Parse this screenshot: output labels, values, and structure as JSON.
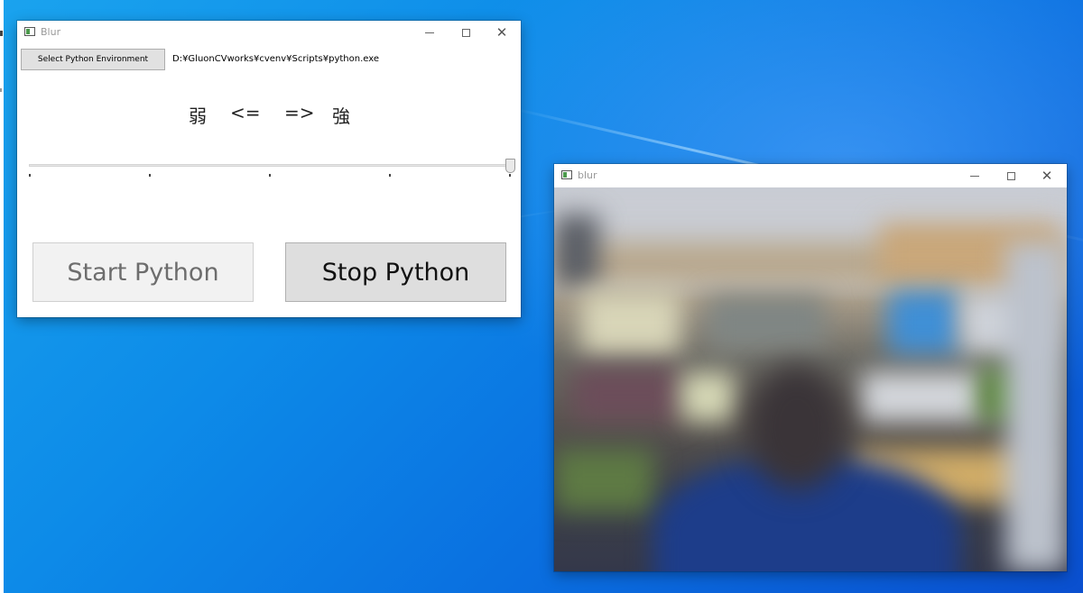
{
  "main_window": {
    "title": "Blur",
    "select_button_label": "Select Python Environment",
    "python_path": "D:¥GluonCVworks¥cvenv¥Scripts¥python.exe",
    "strength_label": {
      "weak": "弱",
      "left_arrow": "<=",
      "right_arrow": "=>",
      "strong": "強"
    },
    "slider": {
      "value": 1.0,
      "ticks": 5
    },
    "start_button_label": "Start Python",
    "stop_button_label": "Stop Python",
    "start_button_enabled": false
  },
  "preview_window": {
    "title": "blur"
  },
  "caption_icons": [
    "minimize-icon",
    "maximize-icon",
    "close-icon"
  ],
  "colors": {
    "desktop_blue": "#0d8be8",
    "button_face": "#e1e1e1",
    "disabled_text": "#6d6d6d"
  }
}
